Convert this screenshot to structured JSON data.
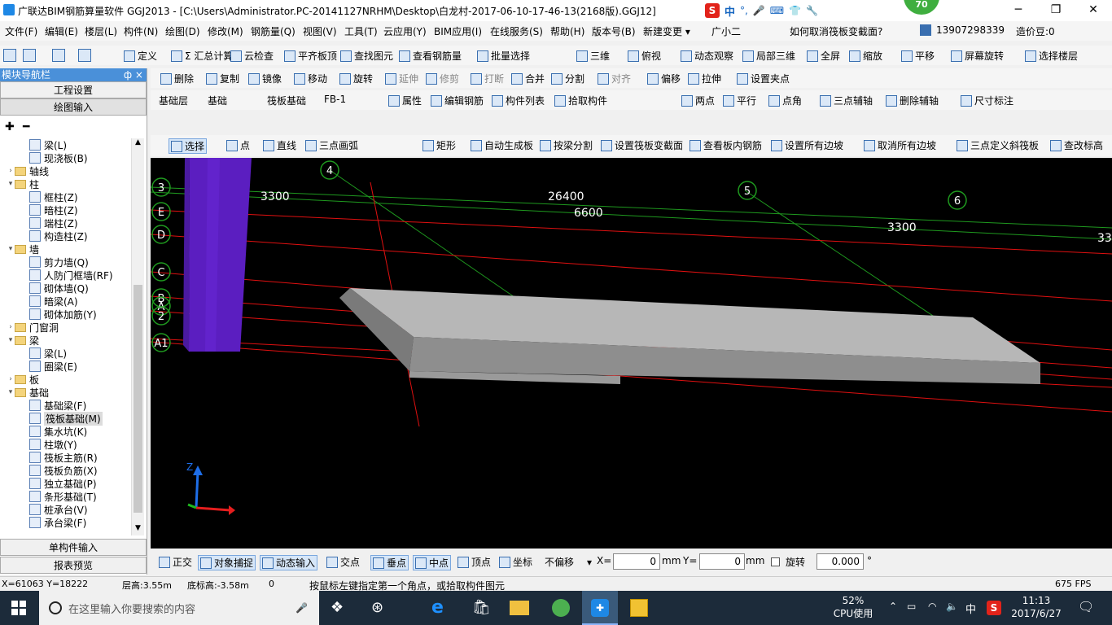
{
  "window": {
    "title": "广联达BIM钢筋算量软件 GGJ2013 - [C:\\Users\\Administrator.PC-20141127NRHM\\Desktop\\白龙村-2017-06-10-17-46-13(2168版).GGJ12]",
    "badge": "70",
    "ime": "中"
  },
  "menu": {
    "items": [
      "文件(F)",
      "编辑(E)",
      "楼层(L)",
      "构件(N)",
      "绘图(D)",
      "修改(M)",
      "钢筋量(Q)",
      "视图(V)",
      "工具(T)",
      "云应用(Y)",
      "BIM应用(I)",
      "在线服务(S)",
      "帮助(H)",
      "版本号(B)",
      "新建变更 ▾",
      "广小二",
      "如何取消筏板变截面?"
    ],
    "phone": "13907298339",
    "beans": "造价豆:0"
  },
  "toolbar1": {
    "items": [
      "定义",
      "Σ 汇总计算",
      "云检查",
      "平齐板顶",
      "查找图元",
      "查看钢筋量",
      "批量选择",
      "三维",
      "俯视",
      "动态观察",
      "局部三维",
      "全屏",
      "缩放",
      "平移",
      "屏幕旋转",
      "选择楼层"
    ]
  },
  "toolbar2": {
    "items": [
      "删除",
      "复制",
      "镜像",
      "移动",
      "旋转",
      "延伸",
      "修剪",
      "打断",
      "合并",
      "分割",
      "对齐",
      "偏移",
      "拉伸",
      "设置夹点"
    ]
  },
  "toolbar3": {
    "layer": "基础层",
    "layer_val": "基础",
    "type": "筏板基础",
    "name": "FB-1",
    "items": [
      "属性",
      "编辑钢筋",
      "构件列表",
      "拾取构件"
    ],
    "right": [
      "两点",
      "平行",
      "点角",
      "三点辅轴",
      "删除辅轴",
      "尺寸标注"
    ]
  },
  "toolbar4": {
    "items": [
      "选择",
      "点",
      "直线",
      "三点画弧",
      "矩形",
      "自动生成板",
      "按梁分割",
      "设置筏板变截面",
      "查看板内钢筋",
      "设置所有边坡",
      "取消所有边坡",
      "三点定义斜筏板",
      "查改标高"
    ]
  },
  "leftpanel": {
    "title": "模块导航栏",
    "pin": "ф ×",
    "btn1": "工程设置",
    "btn2": "绘图输入",
    "btn3": "单构件输入",
    "btn4": "报表预览",
    "tree": [
      {
        "lvl": 2,
        "label": "梁(L)",
        "kind": "node"
      },
      {
        "lvl": 2,
        "label": "现浇板(B)",
        "kind": "node"
      },
      {
        "lvl": 1,
        "label": "轴线",
        "kind": "folder",
        "tw": ">"
      },
      {
        "lvl": 1,
        "label": "柱",
        "kind": "folder",
        "tw": "v"
      },
      {
        "lvl": 2,
        "label": "框柱(Z)",
        "kind": "node"
      },
      {
        "lvl": 2,
        "label": "暗柱(Z)",
        "kind": "node"
      },
      {
        "lvl": 2,
        "label": "端柱(Z)",
        "kind": "node"
      },
      {
        "lvl": 2,
        "label": "构造柱(Z)",
        "kind": "node"
      },
      {
        "lvl": 1,
        "label": "墙",
        "kind": "folder",
        "tw": "v"
      },
      {
        "lvl": 2,
        "label": "剪力墙(Q)",
        "kind": "node"
      },
      {
        "lvl": 2,
        "label": "人防门框墙(RF)",
        "kind": "node"
      },
      {
        "lvl": 2,
        "label": "砌体墙(Q)",
        "kind": "node"
      },
      {
        "lvl": 2,
        "label": "暗梁(A)",
        "kind": "node"
      },
      {
        "lvl": 2,
        "label": "砌体加筋(Y)",
        "kind": "node"
      },
      {
        "lvl": 1,
        "label": "门窗洞",
        "kind": "folder",
        "tw": ">"
      },
      {
        "lvl": 1,
        "label": "梁",
        "kind": "folder",
        "tw": "v"
      },
      {
        "lvl": 2,
        "label": "梁(L)",
        "kind": "node"
      },
      {
        "lvl": 2,
        "label": "圈梁(E)",
        "kind": "node"
      },
      {
        "lvl": 1,
        "label": "板",
        "kind": "folder",
        "tw": ">"
      },
      {
        "lvl": 1,
        "label": "基础",
        "kind": "folder",
        "tw": "v"
      },
      {
        "lvl": 2,
        "label": "基础梁(F)",
        "kind": "node"
      },
      {
        "lvl": 2,
        "label": "筏板基础(M)",
        "kind": "node",
        "sel": true
      },
      {
        "lvl": 2,
        "label": "集水坑(K)",
        "kind": "node"
      },
      {
        "lvl": 2,
        "label": "柱墩(Y)",
        "kind": "node"
      },
      {
        "lvl": 2,
        "label": "筏板主筋(R)",
        "kind": "node"
      },
      {
        "lvl": 2,
        "label": "筏板负筋(X)",
        "kind": "node"
      },
      {
        "lvl": 2,
        "label": "独立基础(P)",
        "kind": "node"
      },
      {
        "lvl": 2,
        "label": "条形基础(T)",
        "kind": "node"
      },
      {
        "lvl": 2,
        "label": "桩承台(V)",
        "kind": "node"
      },
      {
        "lvl": 2,
        "label": "承台梁(F)",
        "kind": "node"
      }
    ]
  },
  "viewport": {
    "axes": [
      "4",
      "5",
      "6",
      "3",
      "E",
      "D",
      "C",
      "B",
      "A",
      "2",
      "A1"
    ],
    "dims": [
      "3300",
      "26400",
      "6600",
      "3300",
      "33"
    ],
    "axis_z": "Z"
  },
  "snapbar": {
    "items": [
      "正交",
      "对象捕捉",
      "动态输入",
      "交点",
      "垂点",
      "中点",
      "顶点",
      "坐标"
    ],
    "offset": "不偏移",
    "x_label": "X=",
    "x_val": "0",
    "mm1": "mm",
    "y_label": "Y=",
    "y_val": "0",
    "mm2": "mm",
    "rot_label": "旋转",
    "rot_val": "0.000",
    "deg": "°"
  },
  "status": {
    "coords": "X=61063 Y=18222",
    "floor_h": "层高:3.55m",
    "bottom": "底标高:-3.58m",
    "zero": "0",
    "hint": "按鼠标左键指定第一个角点，或拾取构件图元",
    "fps": "675 FPS"
  },
  "taskbar": {
    "search": "在这里输入你要搜索的内容",
    "cpu": "52%",
    "cpu_label": "CPU使用",
    "time": "11:13",
    "date": "2017/6/27",
    "ime": "中"
  }
}
